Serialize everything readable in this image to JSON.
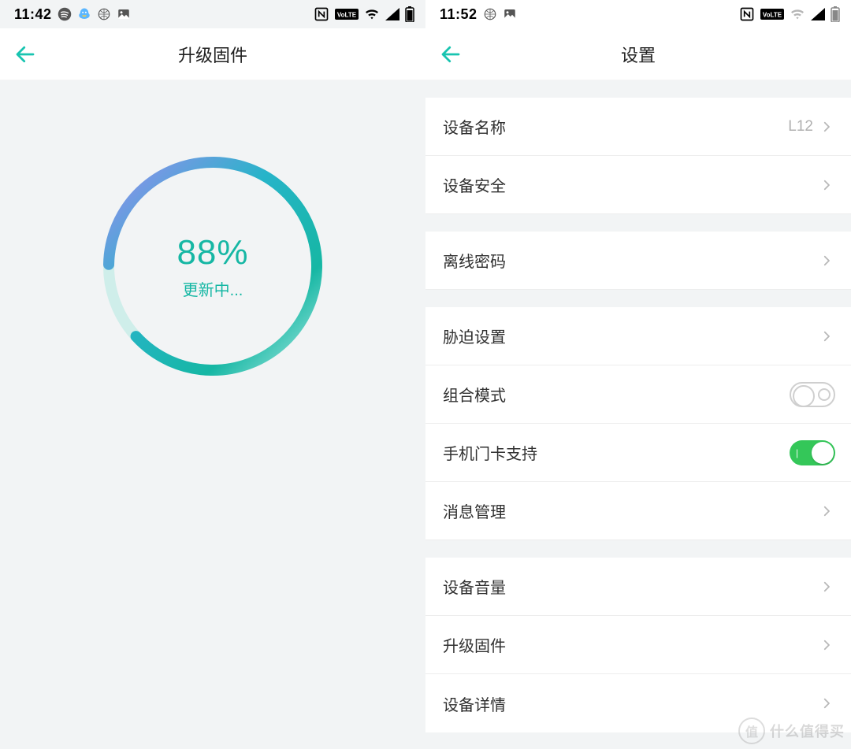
{
  "left": {
    "status": {
      "time": "11:42"
    },
    "nav": {
      "title": "升级固件"
    },
    "firmware": {
      "percent": "88%",
      "status_text": "更新中...",
      "progress_value": 88
    }
  },
  "right": {
    "status": {
      "time": "11:52"
    },
    "nav": {
      "title": "设置"
    },
    "groups": [
      {
        "rows": [
          {
            "label": "设备名称",
            "value": "L12",
            "type": "chevron"
          },
          {
            "label": "设备安全",
            "type": "chevron"
          }
        ]
      },
      {
        "rows": [
          {
            "label": "离线密码",
            "type": "chevron"
          }
        ]
      },
      {
        "rows": [
          {
            "label": "胁迫设置",
            "type": "chevron"
          },
          {
            "label": "组合模式",
            "type": "toggle",
            "on": false
          },
          {
            "label": "手机门卡支持",
            "type": "toggle",
            "on": true
          },
          {
            "label": "消息管理",
            "type": "chevron"
          }
        ]
      },
      {
        "rows": [
          {
            "label": "设备音量",
            "type": "chevron"
          },
          {
            "label": "升级固件",
            "type": "chevron"
          },
          {
            "label": "设备详情",
            "type": "chevron"
          }
        ]
      }
    ]
  },
  "watermark": {
    "badge": "值",
    "text": "什么值得买"
  },
  "icons": {
    "spotify": "spotify-icon",
    "qq": "qq-icon",
    "globe": "globe-icon",
    "gallery": "gallery-icon",
    "nfc": "nfc-icon",
    "volte": "volte-icon",
    "wifi": "wifi-icon",
    "signal": "signal-icon",
    "battery": "battery-icon"
  }
}
